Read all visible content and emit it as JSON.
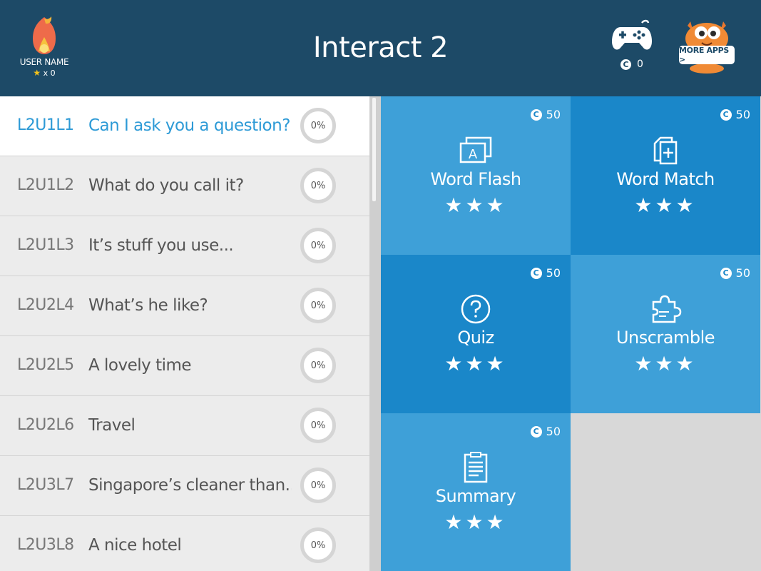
{
  "header": {
    "title": "Interact 2",
    "user_name": "USER NAME",
    "user_stars": "x 0",
    "coins": "0",
    "more_apps_label": "MORE APPS >",
    "bg_color": "#1d4a67"
  },
  "lessons": [
    {
      "code": "L2U1L1",
      "title": "Can I ask you a question?",
      "progress": "0%",
      "active": true
    },
    {
      "code": "L2U1L2",
      "title": "What do you call it?",
      "progress": "0%"
    },
    {
      "code": "L2U1L3",
      "title": "It’s stuff you use...",
      "progress": "0%"
    },
    {
      "code": "L2U2L4",
      "title": "What’s he like?",
      "progress": "0%"
    },
    {
      "code": "L2U2L5",
      "title": "A lovely time",
      "progress": "0%"
    },
    {
      "code": "L2U2L6",
      "title": "Travel",
      "progress": "0%"
    },
    {
      "code": "L2U3L7",
      "title": "Singapore’s cleaner than...",
      "progress": "0%"
    },
    {
      "code": "L2U3L8",
      "title": "A nice hotel",
      "progress": "0%"
    }
  ],
  "activities": [
    {
      "name": "Word Flash",
      "cost": "50",
      "stars": "★★★",
      "icon": "word-flash-icon"
    },
    {
      "name": "Word Match",
      "cost": "50",
      "stars": "★★★",
      "icon": "word-match-icon"
    },
    {
      "name": "Quiz",
      "cost": "50",
      "stars": "★★★",
      "icon": "quiz-icon"
    },
    {
      "name": "Unscramble",
      "cost": "50",
      "stars": "★★★",
      "icon": "puzzle-icon"
    },
    {
      "name": "Summary",
      "cost": "50",
      "stars": "★★★",
      "icon": "summary-icon"
    }
  ],
  "colors": {
    "active_text": "#2d9ad6",
    "tile_light": "#3ea0d8",
    "tile_dark": "#1a87c9"
  }
}
